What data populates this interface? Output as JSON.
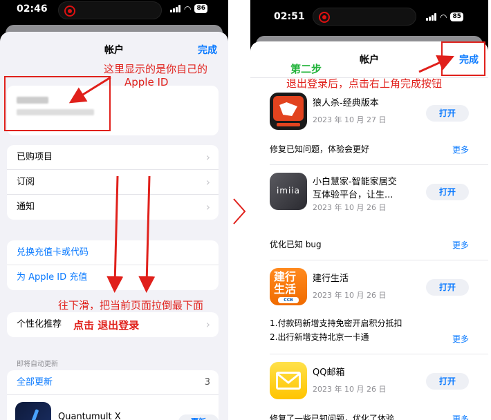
{
  "left": {
    "status": {
      "time": "02:46",
      "battery": "86"
    },
    "nav": {
      "title": "帐户",
      "done": "完成"
    },
    "annotations": {
      "apple_id_line1": "这里显示的是你自己的",
      "apple_id_line2": "Apple ID",
      "scroll_hint": "往下滑，把当前页面拉倒最下面",
      "click_logout": "点击 退出登录"
    },
    "menu1": [
      "已购项目",
      "订阅",
      "通知"
    ],
    "menu2": [
      "兑换充值卡或代码",
      "为 Apple ID 充值"
    ],
    "personalized": "个性化推荐",
    "auto_update_header": "即将自动更新",
    "update_all": {
      "label": "全部更新",
      "count": "3"
    },
    "app_partial": {
      "name": "Quantumult X",
      "button": "更新"
    }
  },
  "right": {
    "status": {
      "time": "02:51",
      "battery": "85"
    },
    "nav": {
      "title": "帐户",
      "done": "完成"
    },
    "annotations": {
      "step": "第二步",
      "instruction": "退出登录后，点击右上角完成按钮"
    },
    "apps": [
      {
        "name": "狼人杀-经典版本",
        "date": "2023 年 10 月 27 日",
        "button": "打开",
        "notes": [
          "修复已知问题，体验会更好"
        ],
        "more": "更多"
      },
      {
        "name": "小白慧家-智能家居交互体验平台，让生...",
        "name_l1": "小白慧家-智能家居交",
        "name_l2": "互体验平台，让生...",
        "date": "2023 年 10 月 26 日",
        "button": "打开",
        "notes": [
          "优化已知 bug"
        ],
        "more": "更多"
      },
      {
        "name": "建行生活",
        "date": "2023 年 10 月 26 日",
        "button": "打开",
        "notes": [
          "1.付款码新增支持免密开启积分抵扣",
          "2.出行新增支持北京一卡通"
        ],
        "more": "更多",
        "icon_text": "建行生活",
        "icon_badge": "CCB"
      },
      {
        "name": "QQ邮箱",
        "date": "2023 年 10 月 26 日",
        "button": "打开",
        "notes": [
          "修复了一些已知问题，优化了体验"
        ],
        "more": "更多"
      }
    ],
    "icon_labels": {
      "xiaobai": "imiia"
    }
  },
  "colors": {
    "ios_blue": "#0a7aff",
    "annotation_red": "#e0201b",
    "annotation_green": "#21b33a"
  }
}
